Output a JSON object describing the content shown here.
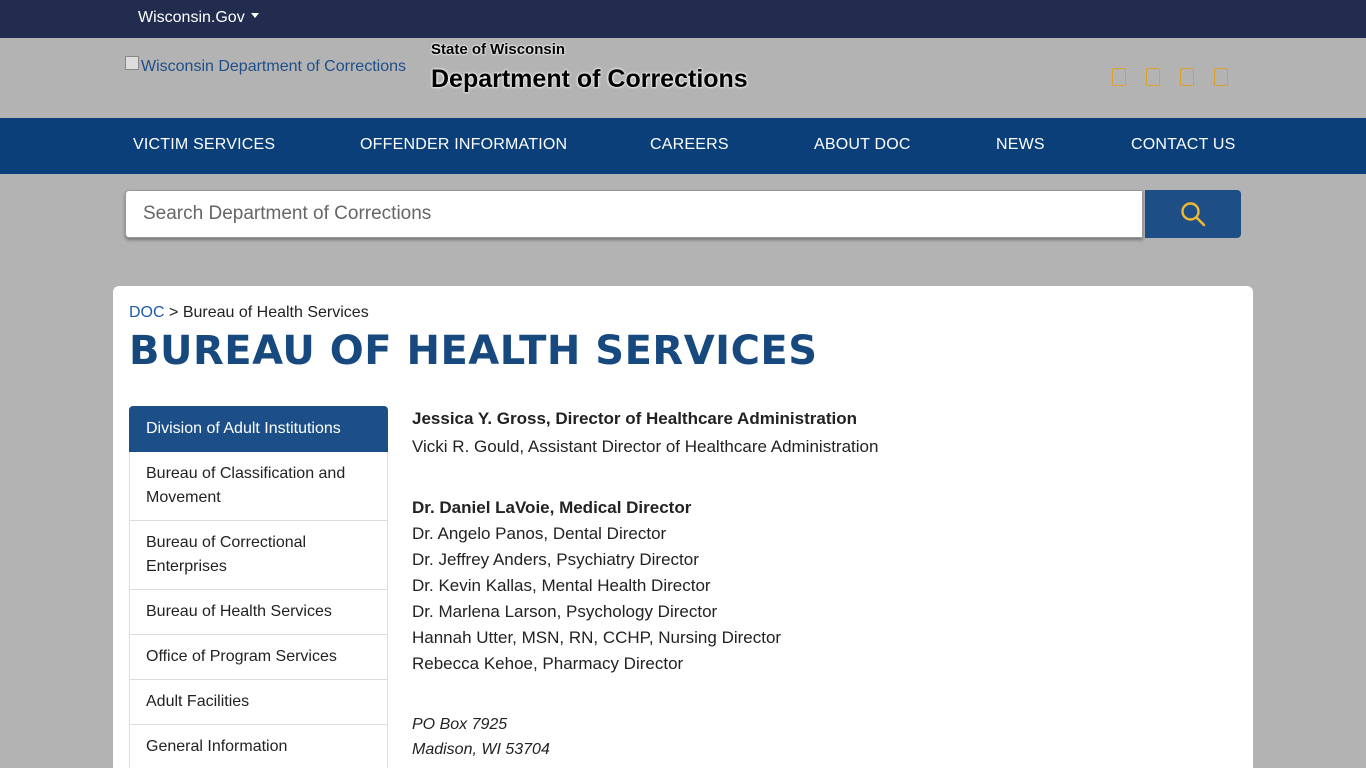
{
  "topbar": {
    "wigov": "Wisconsin.Gov"
  },
  "header": {
    "logo_alt": "Wisconsin Department of Corrections",
    "subtitle": "State of Wisconsin",
    "title": "Department of Corrections",
    "social_icons": [
      "facebook-icon",
      "twitter-icon",
      "youtube-icon",
      "linkedin-icon"
    ],
    "accent_color": "#d9a12b"
  },
  "nav": {
    "items": [
      "VICTIM SERVICES",
      "OFFENDER INFORMATION",
      "CAREERS",
      "ABOUT DOC",
      "NEWS",
      "CONTACT US"
    ]
  },
  "search": {
    "placeholder": "Search Department of Corrections"
  },
  "breadcrumb": {
    "root": "DOC",
    "sep": ">",
    "current": "Bureau of Health Services"
  },
  "page_title": "BUREAU OF HEALTH SERVICES",
  "sidenav": {
    "items": [
      "Division of Adult Institutions",
      "Bureau of Classification and Movement",
      "Bureau of Correctional Enterprises",
      "Bureau of Health Services",
      "Office of Program Services",
      "Adult Facilities",
      "General Information"
    ]
  },
  "staff": {
    "director": "Jessica Y. Gross, Director of Healthcare Administration",
    "asst_director": "Vicki R. Gould, Assistant Director of Healthcare Administration",
    "medical_director": "Dr. Daniel LaVoie, Medical Director",
    "others": [
      "Dr. Angelo Panos, Dental Director",
      "Dr. Jeffrey Anders, Psychiatry Director",
      "Dr. Kevin Kallas, Mental Health Director",
      "Dr. Marlena Larson, Psychology Director",
      "Hannah Utter, MSN, RN, CCHP, Nursing Director",
      "Rebecca Kehoe, Pharmacy Director"
    ]
  },
  "address": {
    "line1": "PO Box 7925",
    "line2": "Madison, WI 53704"
  },
  "colors": {
    "topbar": "#212c4f",
    "nav": "#0a3f7a",
    "title": "#17497e",
    "link": "#1f5ba8"
  }
}
